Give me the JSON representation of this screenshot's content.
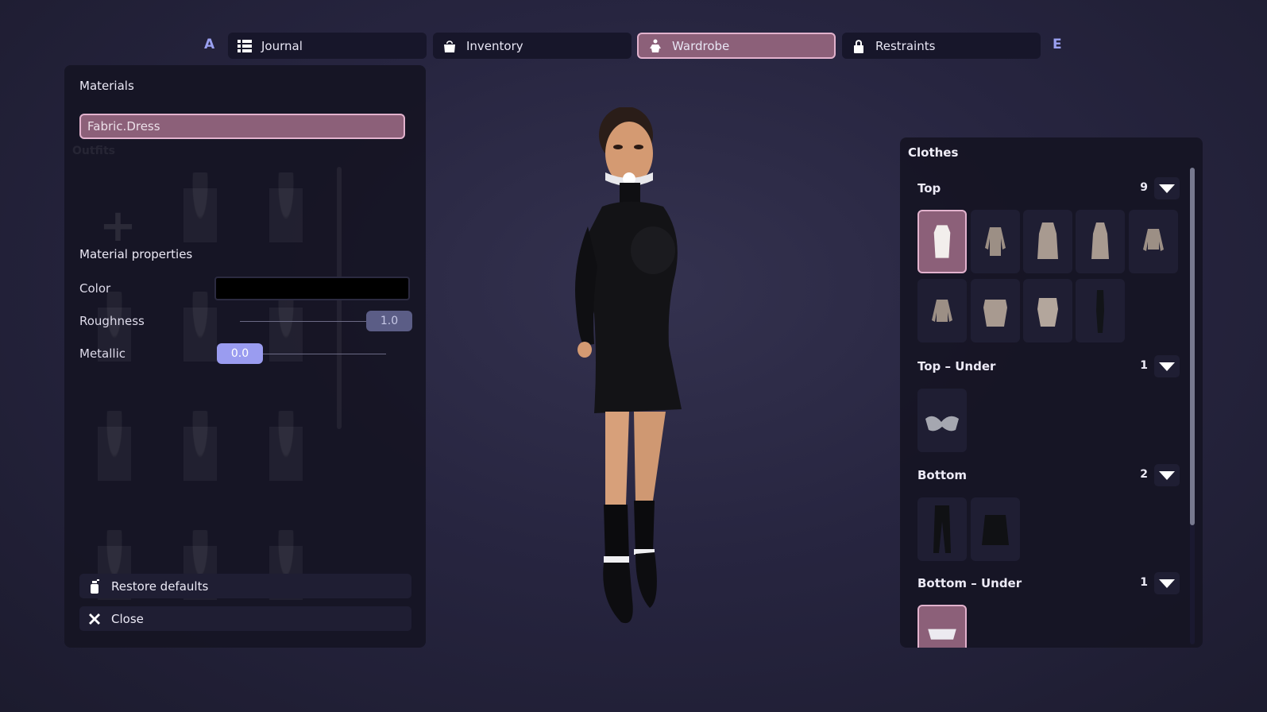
{
  "nav": {
    "left_key": "A",
    "right_key": "E",
    "tabs": [
      {
        "label": "Journal",
        "icon": "list-icon"
      },
      {
        "label": "Inventory",
        "icon": "bag-icon"
      },
      {
        "label": "Wardrobe",
        "icon": "hanger-icon",
        "active": true
      },
      {
        "label": "Restraints",
        "icon": "lock-icon"
      }
    ]
  },
  "materials": {
    "title": "Materials",
    "selected_material": "Fabric.Dress",
    "background_section_title": "Outfits",
    "properties_title": "Material properties",
    "color_label": "Color",
    "color_value": "#000000",
    "roughness_label": "Roughness",
    "roughness_value": "1.0",
    "metallic_label": "Metallic",
    "metallic_value": "0.0",
    "restore_label": "Restore defaults",
    "close_label": "Close"
  },
  "clothes": {
    "title": "Clothes",
    "categories": [
      {
        "name": "Top",
        "count": "9"
      },
      {
        "name": "Top – Under",
        "count": "1"
      },
      {
        "name": "Bottom",
        "count": "2"
      },
      {
        "name": "Bottom – Under",
        "count": "1"
      }
    ]
  },
  "colors": {
    "accent": "#8c6079",
    "accent_border": "#e2b2cd",
    "nav_key": "#9aa0f0",
    "slider_active": "#9a9cf0"
  }
}
